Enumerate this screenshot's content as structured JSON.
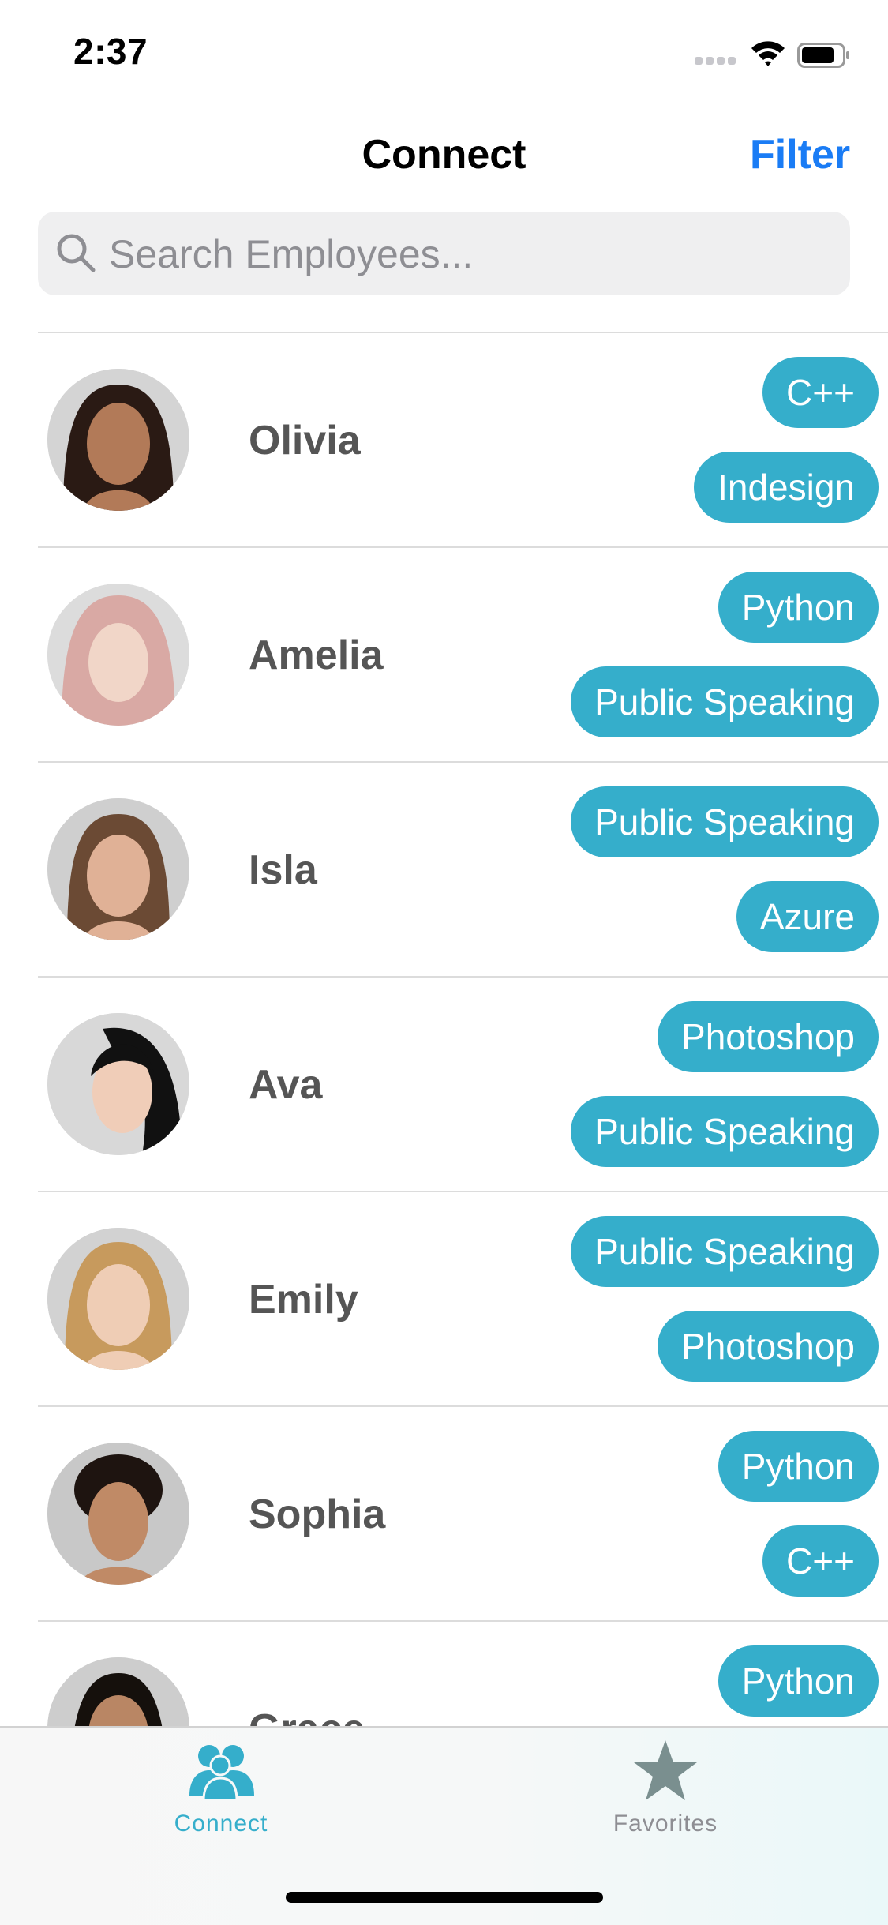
{
  "status_bar": {
    "time": "2:37"
  },
  "nav": {
    "title": "Connect",
    "filter_label": "Filter"
  },
  "search": {
    "placeholder": "Search Employees...",
    "value": ""
  },
  "employees": [
    {
      "name": "Olivia",
      "tags": [
        "C++",
        "Indesign"
      ]
    },
    {
      "name": "Amelia",
      "tags": [
        "Python",
        "Public Speaking"
      ]
    },
    {
      "name": "Isla",
      "tags": [
        "Public Speaking",
        "Azure"
      ]
    },
    {
      "name": "Ava",
      "tags": [
        "Photoshop",
        "Public Speaking"
      ]
    },
    {
      "name": "Emily",
      "tags": [
        "Public Speaking",
        "Photoshop"
      ]
    },
    {
      "name": "Sophia",
      "tags": [
        "Python",
        "C++"
      ]
    },
    {
      "name": "Grace",
      "tags": [
        "Python",
        ""
      ]
    }
  ],
  "tab_bar": {
    "tabs": [
      {
        "label": "Connect",
        "icon": "people-icon",
        "active": true
      },
      {
        "label": "Favorites",
        "icon": "star-icon",
        "active": false
      }
    ]
  },
  "colors": {
    "accent": "#1a7cf5",
    "tag_bg": "#35aecb",
    "tab_active": "#35aecb",
    "tab_inactive": "#8e8e93"
  }
}
